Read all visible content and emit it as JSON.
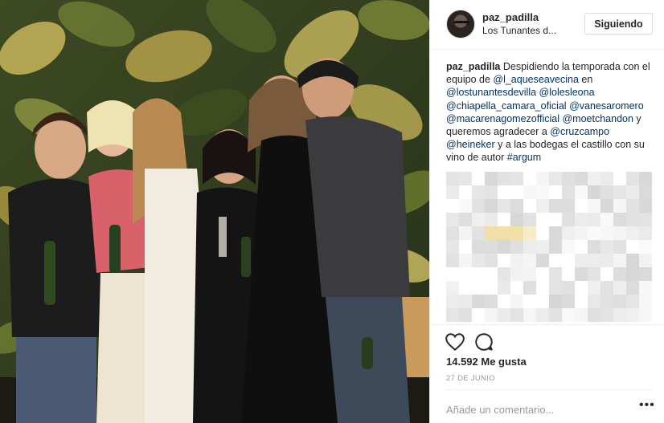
{
  "post": {
    "username": "paz_padilla",
    "location": "Los Tunantes d...",
    "follow_label": "Siguiendo",
    "caption": {
      "username": "paz_padilla",
      "segments": [
        {
          "text": " Despidiendo la temporada con el equipo de ",
          "mention": false
        },
        {
          "text": "@l_aqueseavecina",
          "mention": true
        },
        {
          "text": " en ",
          "mention": false
        },
        {
          "text": "@lostunantesdevilla",
          "mention": true
        },
        {
          "text": " ",
          "mention": false
        },
        {
          "text": "@lolesleona",
          "mention": true
        },
        {
          "text": " ",
          "mention": false
        },
        {
          "text": "@chiapella_camara_oficial",
          "mention": true
        },
        {
          "text": " ",
          "mention": false
        },
        {
          "text": "@vanesaromero",
          "mention": true
        },
        {
          "text": " ",
          "mention": false
        },
        {
          "text": "@macarenagomezofficial",
          "mention": true
        },
        {
          "text": " ",
          "mention": false
        },
        {
          "text": "@moetchandon",
          "mention": true
        },
        {
          "text": " y queremos agradecer a ",
          "mention": false
        },
        {
          "text": "@cruzcampo",
          "mention": true
        },
        {
          "text": " ",
          "mention": false
        },
        {
          "text": "@heineker",
          "mention": true
        },
        {
          "text": " y a las bodegas el castillo con su vino de autor ",
          "mention": false
        },
        {
          "text": "#argum",
          "mention": true
        }
      ]
    },
    "likes": "14.592 Me gusta",
    "date": "27 DE JUNIO",
    "comment_placeholder": "Añade un comentario...",
    "more_label": "•••"
  },
  "icons": {
    "like": "heart-icon",
    "comment": "comment-icon",
    "more": "more-options-icon"
  },
  "colors": {
    "mention": "#003569",
    "text": "#262626",
    "muted": "#999999",
    "border": "#dbdbdb"
  }
}
